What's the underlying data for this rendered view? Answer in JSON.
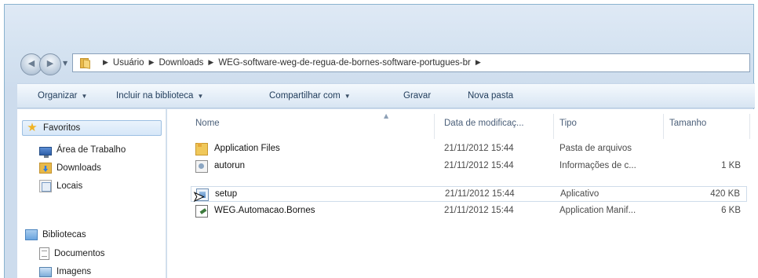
{
  "address_bar": {
    "crumbs": [
      "Usuário",
      "Downloads",
      "WEG-software-weg-de-regua-de-bornes-software-portugues-br"
    ]
  },
  "toolbar": {
    "organizar": "Organizar",
    "incluir": "Incluir na biblioteca",
    "compartilhar": "Compartilhar com",
    "gravar": "Gravar",
    "nova_pasta": "Nova pasta"
  },
  "nav": {
    "favoritos": "Favoritos",
    "area_trabalho": "Área de Trabalho",
    "downloads": "Downloads",
    "locais": "Locais",
    "bibliotecas": "Bibliotecas",
    "documentos": "Documentos",
    "imagens": "Imagens"
  },
  "columns": {
    "nome": "Nome",
    "data": "Data de modificaç...",
    "tipo": "Tipo",
    "tamanho": "Tamanho"
  },
  "files": [
    {
      "name": "Application Files",
      "date": "21/11/2012 15:44",
      "type": "Pasta de arquivos",
      "size": ""
    },
    {
      "name": "autorun",
      "date": "21/11/2012 15:44",
      "type": "Informações de c...",
      "size": "1 KB"
    },
    {
      "name": "setup",
      "date": "21/11/2012 15:44",
      "type": "Aplicativo",
      "size": "420 KB"
    },
    {
      "name": "WEG.Automacao.Bornes",
      "date": "21/11/2012 15:44",
      "type": "Application Manif...",
      "size": "6 KB"
    }
  ],
  "icons": {
    "star": "star-icon",
    "folder": "folder-icon",
    "cursor": "mouse-cursor-icon"
  },
  "colors": {
    "chrome": "#d5e3f1",
    "selection_border": "#9dbfe2",
    "toolbar_text": "#1f3b5a"
  }
}
